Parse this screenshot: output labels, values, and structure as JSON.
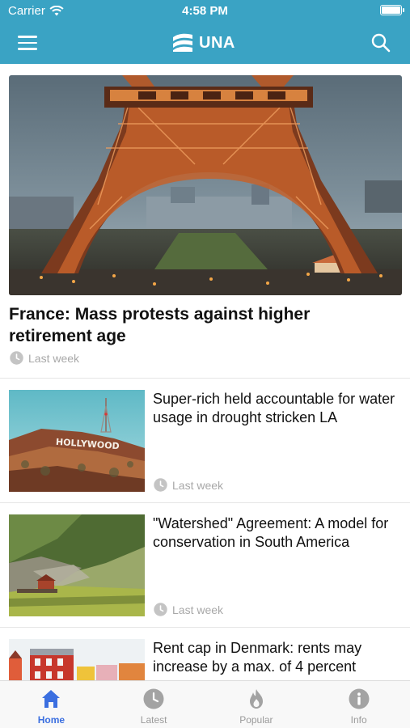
{
  "status_bar": {
    "carrier": "Carrier",
    "time": "4:58 PM"
  },
  "header": {
    "logo_text": "UNA",
    "background_color": "#3aa3c4",
    "menu_icon": "hamburger-menu-icon",
    "search_icon": "search-icon"
  },
  "hero": {
    "title": "France: Mass protests against higher retirement age",
    "time": "Last week",
    "image_subject": "eiffel-tower-photo"
  },
  "articles": [
    {
      "title": "Super-rich held accountable for water usage in drought stricken LA",
      "time": "Last week",
      "image_subject": "hollywood-sign-photo"
    },
    {
      "title": "\"Watershed\" Agreement: A model for conservation in South America",
      "time": "Last week",
      "image_subject": "river-cliff-photo"
    },
    {
      "title": "Rent cap in Denmark: rents may increase by a max. of 4 percent",
      "time": "",
      "image_subject": "colorful-houses-photo"
    }
  ],
  "tabs": [
    {
      "label": "Home",
      "icon": "home-icon",
      "active": true
    },
    {
      "label": "Latest",
      "icon": "clock-icon",
      "active": false
    },
    {
      "label": "Popular",
      "icon": "flame-icon",
      "active": false
    },
    {
      "label": "Info",
      "icon": "info-icon",
      "active": false
    }
  ],
  "colors": {
    "accent_active_tab": "#3b6fe0",
    "meta_gray": "#a8a8a8"
  }
}
